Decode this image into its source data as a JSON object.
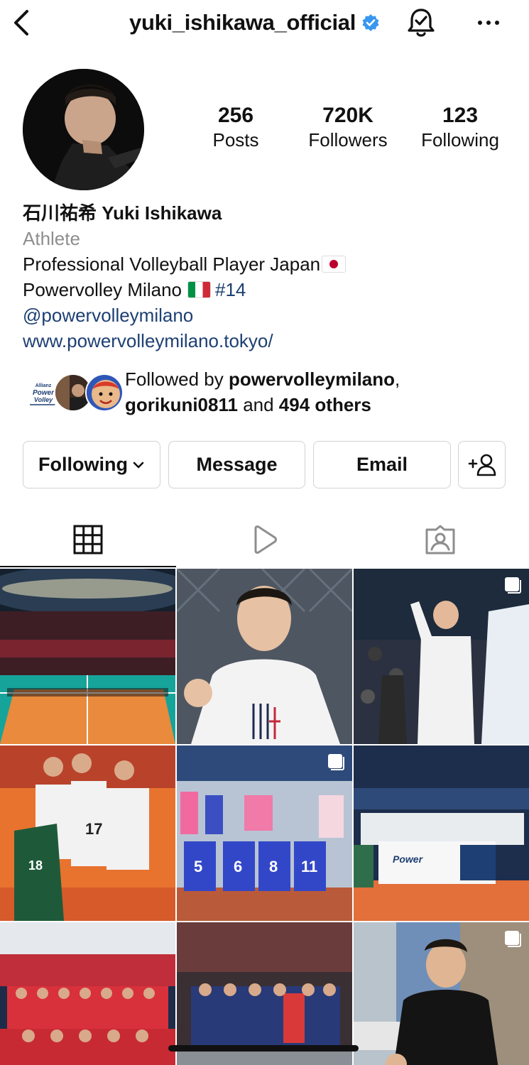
{
  "header": {
    "username": "yuki_ishikawa_official",
    "icons": [
      "back-chevron-icon",
      "verified-badge-icon",
      "notification-bell-icon",
      "more-options-icon"
    ]
  },
  "profile": {
    "avatar": "profile-photo",
    "stats": {
      "posts_value": "256",
      "posts_label": "Posts",
      "followers_value": "720K",
      "followers_label": "Followers",
      "following_value": "123",
      "following_label": "Following"
    },
    "name": "石川祐希 Yuki Ishikawa",
    "category": "Athlete",
    "bio_line1": "Professional Volleyball Player Japan",
    "bio_line2": "Powervolley Milano",
    "bio_hashtag": "#14",
    "mention": "@powervolleymilano",
    "website": "www.powervolleymilano.tokyo/"
  },
  "followed_by": {
    "prefix": "Followed by ",
    "user1": "powervolleymilano",
    "sep": ",",
    "user2": "gorikuni0811",
    "and": " and ",
    "others": "494 others"
  },
  "actions": {
    "following": "Following",
    "message": "Message",
    "email": "Email"
  },
  "tabs": [
    "grid-icon",
    "reels-icon",
    "tagged-icon"
  ],
  "colors": {
    "link": "#1d3f73",
    "verified": "#3897f0",
    "muted": "#8e8e8e",
    "border": "#d2d2d2"
  }
}
